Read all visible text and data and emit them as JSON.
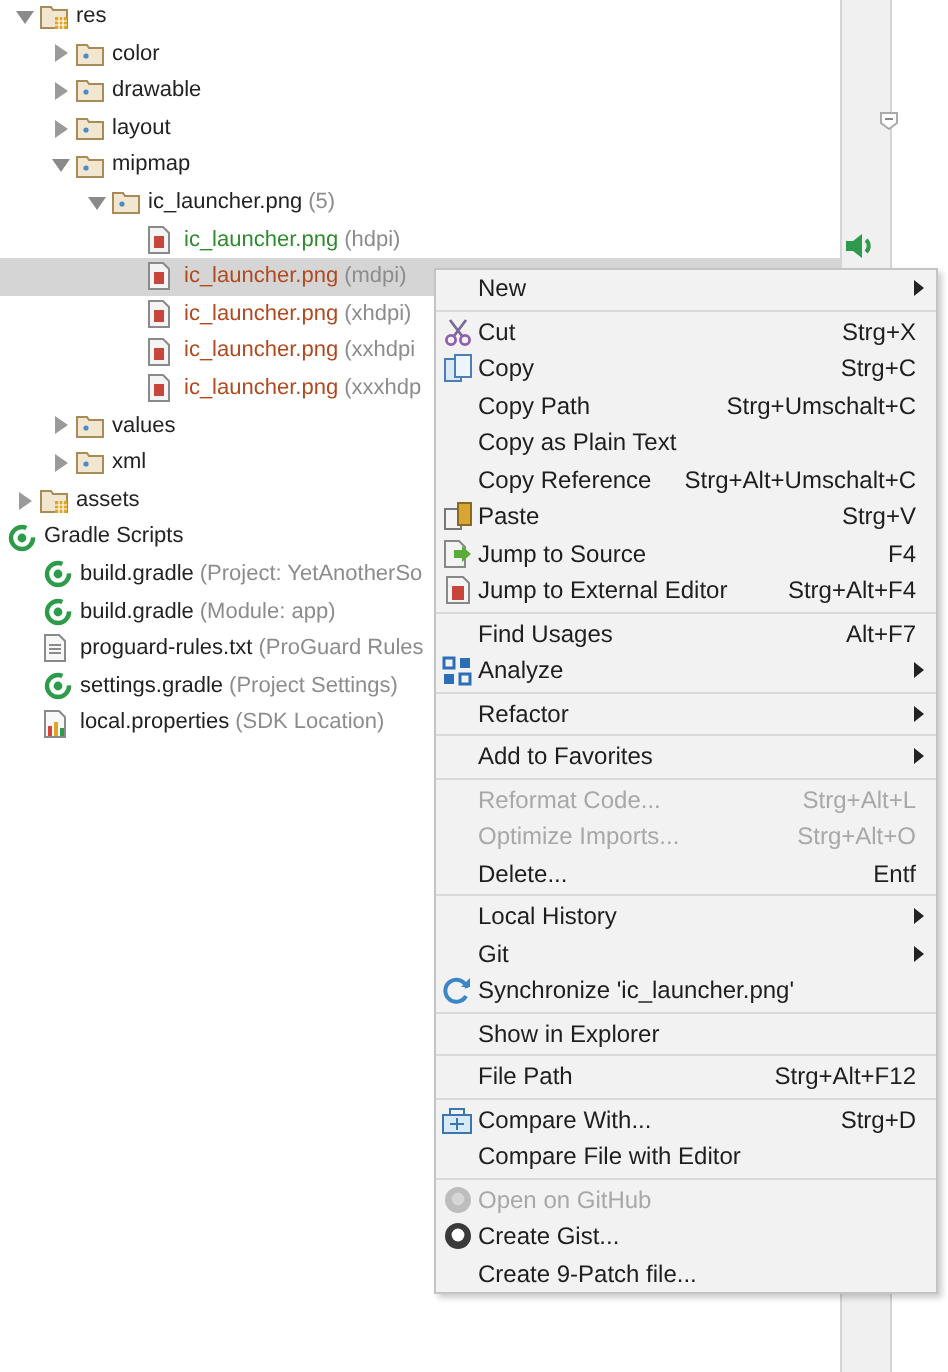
{
  "tree": [
    {
      "label": "res",
      "kind": "res-folder",
      "expanded": true,
      "selected": false,
      "children": [
        {
          "label": "color",
          "kind": "folder",
          "expanded": false,
          "selected": false
        },
        {
          "label": "drawable",
          "kind": "folder",
          "expanded": false,
          "selected": false
        },
        {
          "label": "layout",
          "kind": "folder",
          "expanded": false,
          "selected": false
        },
        {
          "label": "mipmap",
          "kind": "folder",
          "expanded": true,
          "selected": false,
          "children": [
            {
              "label": "ic_launcher.png",
              "note": "(5)",
              "kind": "folder",
              "expanded": true,
              "selected": false,
              "children": [
                {
                  "label": "ic_launcher.png",
                  "note": "(hdpi)",
                  "kind": "image",
                  "color": "#2e8b2e",
                  "selected": false
                },
                {
                  "label": "ic_launcher.png",
                  "note": "(mdpi)",
                  "kind": "image",
                  "color": "#b04a1e",
                  "selected": true
                },
                {
                  "label": "ic_launcher.png",
                  "note": "(xhdpi)",
                  "kind": "image",
                  "color": "#b04a1e",
                  "selected": false
                },
                {
                  "label": "ic_launcher.png",
                  "note": "(xxhdpi",
                  "kind": "image",
                  "color": "#b04a1e",
                  "selected": false
                },
                {
                  "label": "ic_launcher.png",
                  "note": "(xxxhdp",
                  "kind": "image",
                  "color": "#b04a1e",
                  "selected": false
                }
              ]
            }
          ]
        },
        {
          "label": "values",
          "kind": "folder",
          "expanded": false,
          "selected": false
        },
        {
          "label": "xml",
          "kind": "folder",
          "expanded": false,
          "selected": false
        }
      ]
    },
    {
      "label": "assets",
      "kind": "res-folder",
      "expanded": false,
      "selected": false
    },
    {
      "label": "Gradle Scripts",
      "kind": "gradle",
      "selected": false,
      "children": [
        {
          "label": "build.gradle",
          "note": "(Project: YetAnotherSo",
          "kind": "gradle",
          "selected": false
        },
        {
          "label": "build.gradle",
          "note": "(Module: app)",
          "kind": "gradle",
          "selected": false
        },
        {
          "label": "proguard-rules.txt",
          "note": "(ProGuard Rules",
          "kind": "text",
          "selected": false
        },
        {
          "label": "settings.gradle",
          "note": "(Project Settings)",
          "kind": "gradle",
          "selected": false
        },
        {
          "label": "local.properties",
          "note": "(SDK Location)",
          "kind": "properties",
          "selected": false
        }
      ]
    }
  ],
  "menu": {
    "groups": [
      [
        {
          "label": "New",
          "submenu": true,
          "disabled": false
        }
      ],
      [
        {
          "label": "Cut",
          "shortcut": "Strg+X",
          "kind": "cut",
          "submenu": false,
          "disabled": false
        },
        {
          "label": "Copy",
          "shortcut": "Strg+C",
          "kind": "copy",
          "submenu": false,
          "disabled": false
        },
        {
          "label": "Copy Path",
          "shortcut": "Strg+Umschalt+C",
          "submenu": false,
          "disabled": false
        },
        {
          "label": "Copy as Plain Text",
          "submenu": false,
          "disabled": false
        },
        {
          "label": "Copy Reference",
          "shortcut": "Strg+Alt+Umschalt+C",
          "submenu": false,
          "disabled": false
        },
        {
          "label": "Paste",
          "shortcut": "Strg+V",
          "kind": "paste",
          "submenu": false,
          "disabled": false
        },
        {
          "label": "Jump to Source",
          "shortcut": "F4",
          "kind": "source",
          "submenu": false,
          "disabled": false
        },
        {
          "label": "Jump to External Editor",
          "shortcut": "Strg+Alt+F4",
          "kind": "external",
          "submenu": false,
          "disabled": false
        }
      ],
      [
        {
          "label": "Find Usages",
          "shortcut": "Alt+F7",
          "submenu": false,
          "disabled": false
        },
        {
          "label": "Analyze",
          "kind": "analyze",
          "submenu": true,
          "disabled": false
        }
      ],
      [
        {
          "label": "Refactor",
          "submenu": true,
          "disabled": false
        }
      ],
      [
        {
          "label": "Add to Favorites",
          "submenu": true,
          "disabled": false
        }
      ],
      [
        {
          "label": "Reformat Code...",
          "shortcut": "Strg+Alt+L",
          "submenu": false,
          "disabled": true
        },
        {
          "label": "Optimize Imports...",
          "shortcut": "Strg+Alt+O",
          "submenu": false,
          "disabled": true
        },
        {
          "label": "Delete...",
          "shortcut": "Entf",
          "submenu": false,
          "disabled": false
        }
      ],
      [
        {
          "label": "Local History",
          "submenu": true,
          "disabled": false
        },
        {
          "label": "Git",
          "submenu": true,
          "disabled": false
        },
        {
          "label": "Synchronize 'ic_launcher.png'",
          "kind": "sync",
          "submenu": false,
          "disabled": false
        }
      ],
      [
        {
          "label": "Show in Explorer",
          "submenu": false,
          "disabled": false
        }
      ],
      [
        {
          "label": "File Path",
          "shortcut": "Strg+Alt+F12",
          "submenu": false,
          "disabled": false
        }
      ],
      [
        {
          "label": "Compare With...",
          "shortcut": "Strg+D",
          "kind": "compare",
          "submenu": false,
          "disabled": false
        },
        {
          "label": "Compare File with Editor",
          "submenu": false,
          "disabled": false
        }
      ],
      [
        {
          "label": "Open on GitHub",
          "kind": "github",
          "submenu": false,
          "disabled": true
        },
        {
          "label": "Create Gist...",
          "kind": "github",
          "submenu": false,
          "disabled": false
        },
        {
          "label": "Create 9-Patch file...",
          "submenu": false,
          "disabled": false
        }
      ]
    ]
  }
}
